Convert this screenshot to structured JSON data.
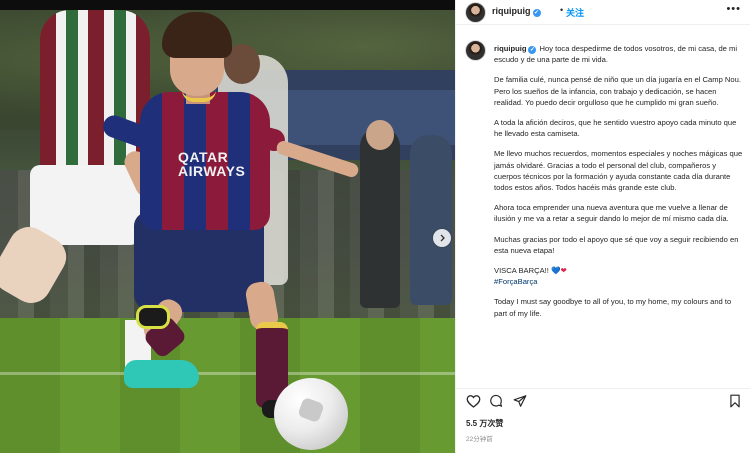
{
  "post": {
    "username": "riquipuig",
    "dot": "•",
    "follow_label": "关注",
    "more_icon": "more-horizontal-icon",
    "sponsor_text": "QATAR\nAIRWAYS",
    "caption_paragraphs": [
      "Hoy toca despedirme de todos vosotros, de mi casa, de mi escudo y de una parte de mi vida.",
      "De familia culé, nunca pensé de niño que un día jugaría en el Camp Nou. Pero los sueños de la infancia, con trabajo y dedicación, se hacen realidad. Yo puedo decir orgulloso que he cumplido mi gran sueño.",
      "A toda la afición deciros, que he sentido vuestro apoyo cada minuto que he llevado esta camiseta.",
      "Me llevo muchos recuerdos, momentos especiales y noches mágicas que jamás olvidaré. Gracias a todo el personal del club, compañeros y cuerpos técnicos por la formación y ayuda constante cada día durante todos estos años. Todos hacéis más grande este club.",
      "Ahora toca emprender una nueva aventura que me vuelve a llenar de ilusión y me va a retar a seguir dando lo mejor de mí mismo cada día.",
      "Muchas gracias por todo el apoyo que sé que voy a seguir recibiendo en esta nueva etapa!"
    ],
    "visca": "VISCA BARÇA!!",
    "hearts": [
      "💙",
      "❤"
    ],
    "hashtag": "#ForçaBarça",
    "english": "Today I must say goodbye to all of you, to my home, my colours and to part of my life.",
    "likes": "5.5 万次赞",
    "time_ago": "22分钟前",
    "icons": {
      "like": "heart-outline-icon",
      "comment": "comment-bubble-icon",
      "share": "paper-plane-icon",
      "save": "bookmark-icon",
      "carousel_next": "chevron-right-icon"
    },
    "colors": {
      "link": "#0095f6",
      "hashtag": "#00376b",
      "verified": "#3897f0"
    }
  }
}
